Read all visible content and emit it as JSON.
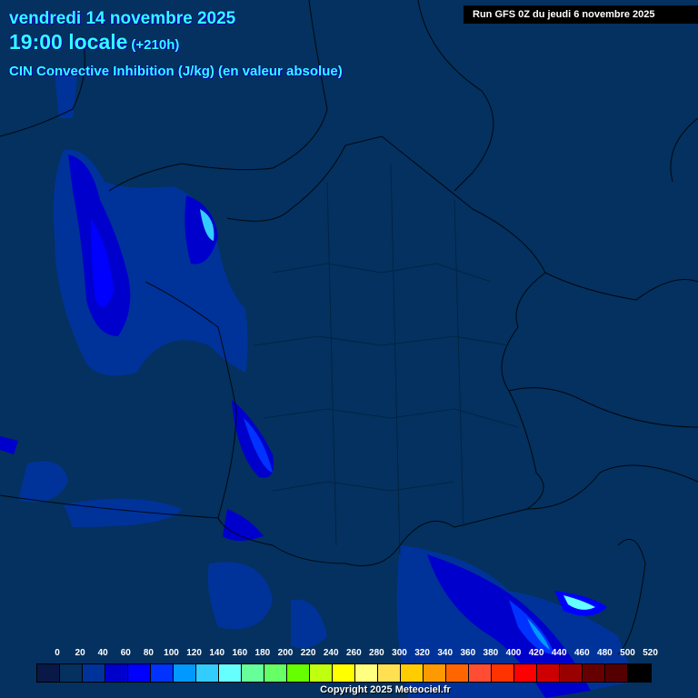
{
  "header": {
    "date": "vendredi 14 novembre 2025",
    "time": "19:00 locale",
    "lead": "(+210h)",
    "parameter": "CIN Convective Inhibition (J/kg) (en valeur absolue)",
    "run": "Run GFS 0Z du jeudi 6 novembre 2025"
  },
  "legend": {
    "labels": [
      "0",
      "20",
      "40",
      "60",
      "80",
      "100",
      "120",
      "140",
      "160",
      "180",
      "200",
      "220",
      "240",
      "260",
      "280",
      "300",
      "320",
      "340",
      "360",
      "380",
      "400",
      "420",
      "440",
      "460",
      "480",
      "500",
      "520"
    ],
    "colors": [
      "#0a1848",
      "#04315f",
      "#003399",
      "#0000cc",
      "#0000ff",
      "#0033ff",
      "#0099ff",
      "#33ccff",
      "#66ffff",
      "#66ff99",
      "#66ff66",
      "#66ff00",
      "#c0ff10",
      "#ffff00",
      "#ffff80",
      "#ffe050",
      "#ffcc00",
      "#ff9900",
      "#ff6600",
      "#ff4d33",
      "#ff3300",
      "#ff0000",
      "#cc0000",
      "#990000",
      "#660000",
      "#550000",
      "#000000"
    ]
  },
  "copyright": "Copyright 2025 Meteociel.fr"
}
